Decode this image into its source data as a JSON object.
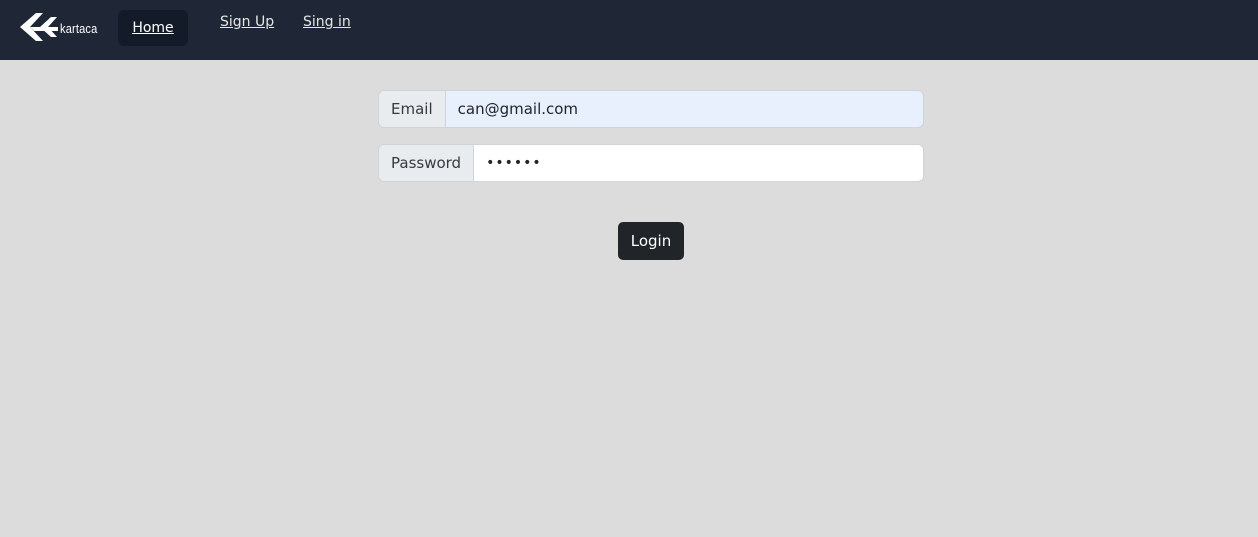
{
  "navbar": {
    "logo_text": "kartaca",
    "logo_icon": "kartaca-chevron-logo-icon",
    "links": [
      {
        "label": "Home"
      },
      {
        "label": "Sign Up"
      },
      {
        "label": "Sing in"
      }
    ]
  },
  "form": {
    "email": {
      "label": "Email",
      "value": "can@gmail.com"
    },
    "password": {
      "label": "Password",
      "value": "••••••"
    },
    "login_label": "Login"
  },
  "colors": {
    "navbar_bg": "#1f2737",
    "page_bg": "#dcdcdc",
    "button_bg": "#212529",
    "autofill_bg": "#e8f0fe"
  }
}
